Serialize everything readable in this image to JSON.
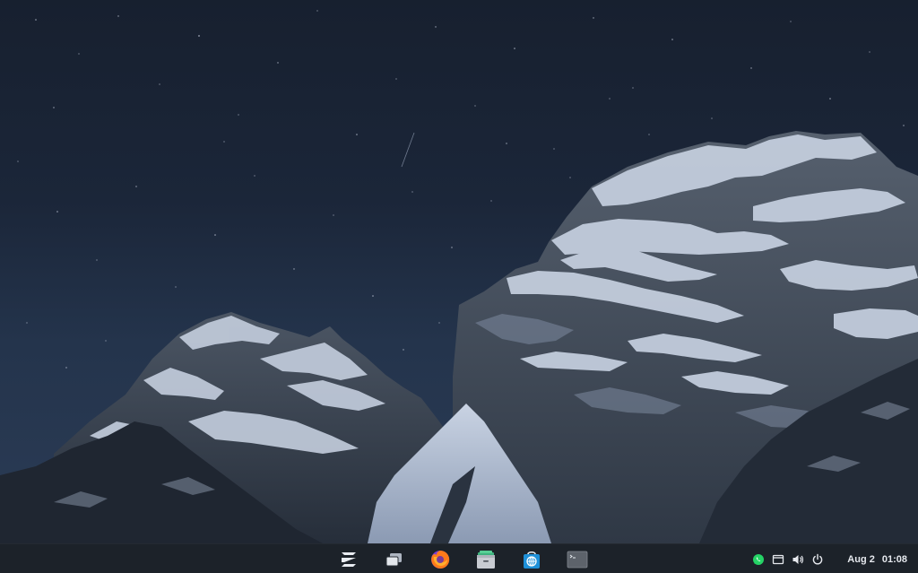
{
  "desktop": {
    "wallpaper": "night-sky-snowy-mountains"
  },
  "taskbar": {
    "dock_items": [
      {
        "name": "zorin-menu-button",
        "icon": "zorin-logo-icon"
      },
      {
        "name": "workspaces-button",
        "icon": "windows-overview-icon"
      },
      {
        "name": "firefox-button",
        "icon": "firefox-icon"
      },
      {
        "name": "files-button",
        "icon": "files-icon"
      },
      {
        "name": "software-store-button",
        "icon": "software-store-icon"
      },
      {
        "name": "terminal-button",
        "icon": "terminal-icon"
      }
    ],
    "tray": {
      "icons": [
        "whatsapp-icon",
        "screen-icon",
        "volume-icon",
        "power-icon"
      ],
      "date": "Aug 2",
      "time": "01:08"
    }
  },
  "colors": {
    "taskbar_bg": "#1c2128",
    "whatsapp": "#25d366",
    "files_green": "#43b581",
    "store_blue": "#1e90d8",
    "terminal_gray": "#6b7077",
    "text": "#e6e9ee"
  }
}
